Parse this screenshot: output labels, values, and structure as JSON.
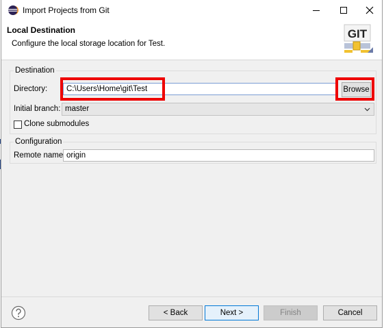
{
  "window": {
    "title": "Import Projects from Git"
  },
  "header": {
    "title": "Local Destination",
    "description": "Configure the local storage location for Test.",
    "logo_text": "GIT"
  },
  "destination": {
    "group_label": "Destination",
    "directory_label": "Directory:",
    "directory_value": "C:\\Users\\Home\\git\\Test",
    "browse_label": "Browse",
    "initial_branch_label": "Initial branch:",
    "initial_branch_value": "master",
    "clone_submodules_label": "Clone submodules",
    "clone_submodules_checked": false
  },
  "configuration": {
    "group_label": "Configuration",
    "remote_name_label": "Remote name:",
    "remote_name_value": "origin"
  },
  "footer": {
    "back_label": "< Back",
    "next_label": "Next >",
    "finish_label": "Finish",
    "cancel_label": "Cancel"
  },
  "colors": {
    "highlight": "#ee0000",
    "focus_border": "#0078d7"
  }
}
